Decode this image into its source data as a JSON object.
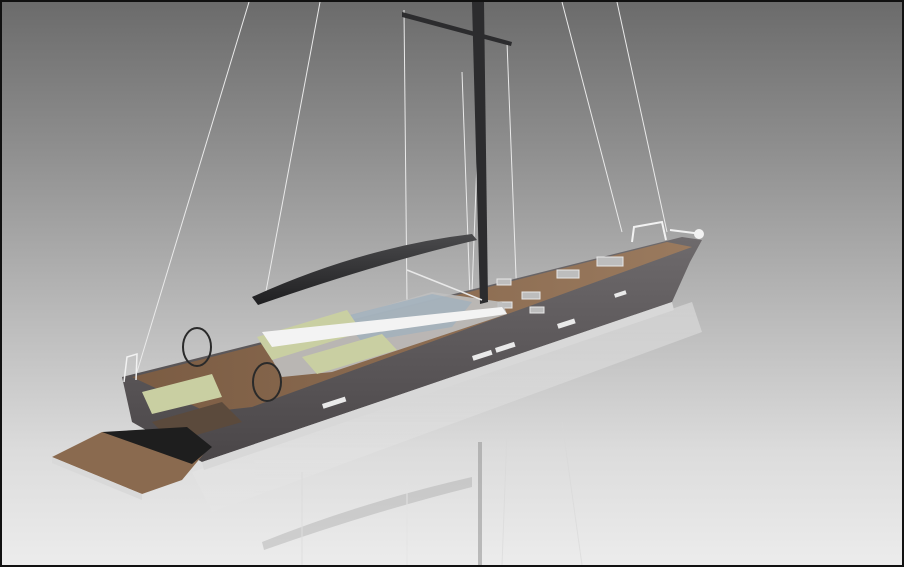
{
  "image": {
    "subject": "",
    "colors": {
      "background_top": "#6b6b6b",
      "background_bottom": "#ececec",
      "hull": "#5a5658",
      "deck": "#8a6a4f",
      "mast": "#2c2c2e",
      "cushions": "#c9cfa2",
      "rigging": "#e8e8e8",
      "border": "#111111"
    }
  }
}
